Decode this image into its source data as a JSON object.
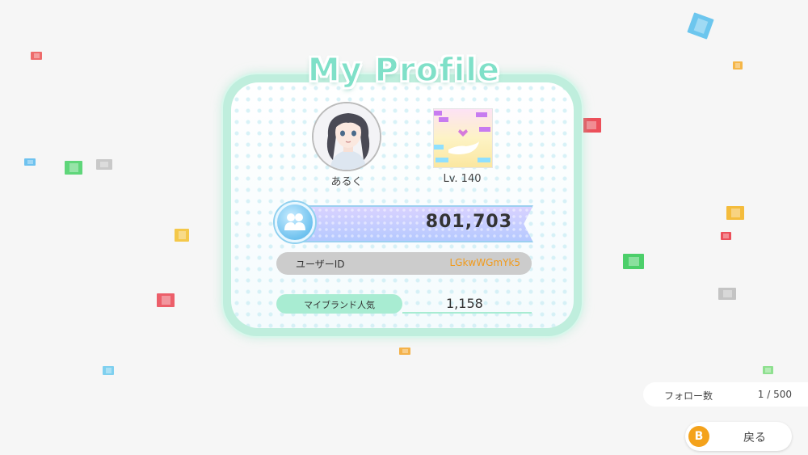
{
  "title": "My Profile",
  "profile": {
    "name": "あるく",
    "level": "Lv. 140",
    "score": "801,703",
    "user_id_label": "ユーザーID",
    "user_id": "LGkwWGmYk5",
    "popularity_label": "マイブランド人気",
    "popularity": "1,158"
  },
  "follow": {
    "label": "フォロー数",
    "value": "1 / 500"
  },
  "back_button": {
    "key": "B",
    "label": "戻る"
  },
  "colors": {
    "title": "#7fe0c8",
    "card_frame": "#bfeedd",
    "user_id_value": "#f19a1a",
    "popularity_pill": "#a8ecd2",
    "back_key": "#f4a21b"
  },
  "icons": {
    "score": "friends-icon",
    "back": "b-button-icon"
  }
}
